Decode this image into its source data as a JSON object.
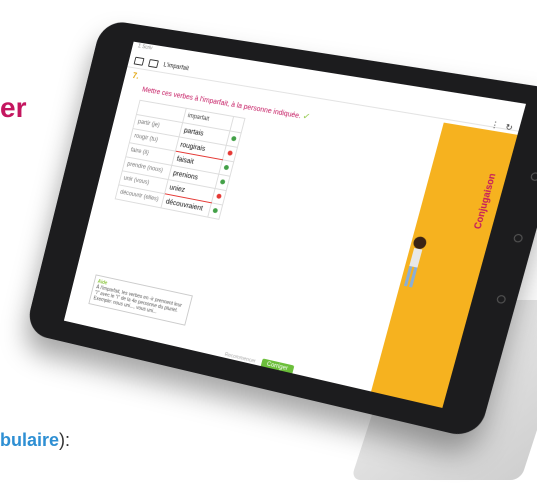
{
  "background": {
    "word_fragment": "er",
    "caption_fragment": "bulaire",
    "caption_suffix": "):"
  },
  "app": {
    "status_left": "Σ  Scriv",
    "toolbar_title": "L'imparfait",
    "exercise_number": "7.",
    "instruction": "Mettre ces verbes à l'imparfait, à la personne indiquée.",
    "table": {
      "header": "imparfait",
      "rows": [
        {
          "label": "partir (je)",
          "answer": "partais",
          "status": "ok"
        },
        {
          "label": "rougir (tu)",
          "answer": "rougirais",
          "status": "no"
        },
        {
          "label": "faire (il)",
          "answer": "faisait",
          "status": "ok"
        },
        {
          "label": "prendre (nous)",
          "answer": "prenions",
          "status": "ok"
        },
        {
          "label": "unir (vous)",
          "answer": "uniez",
          "status": "no"
        },
        {
          "label": "découvrir (elles)",
          "answer": "découvraient",
          "status": "ok"
        }
      ]
    },
    "aide_title": "Aide",
    "aide_text": "À l'imparfait, les verbes en -ir prennent leur \"i\" avec le \"i\" de la 4e personne du pluriel. Exemple: nous uni..., vous uni...",
    "reset_label": "Recommencer",
    "submit_label": "Corriger",
    "side_panel_label": "Conjugaison"
  },
  "colors": {
    "accent": "#c4165f",
    "panel": "#f6b21f",
    "ok": "#43a047",
    "error": "#e53935",
    "button": "#6cbf3b"
  }
}
